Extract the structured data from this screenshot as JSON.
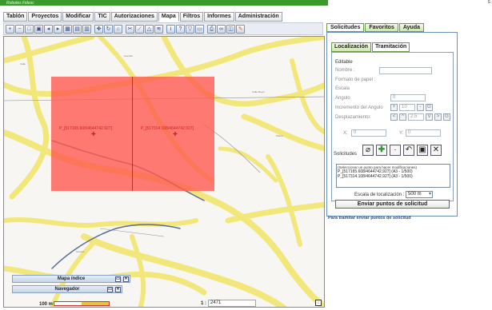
{
  "header": {
    "app_name": "Robotes Fidesc",
    "corner_text": "S"
  },
  "menu": {
    "items": [
      {
        "label": "Tablón"
      },
      {
        "label": "Proyectos"
      },
      {
        "label": "Modificar"
      },
      {
        "label": "TIC"
      },
      {
        "label": "Autorizaciones"
      },
      {
        "label": "Mapa",
        "active": true
      },
      {
        "label": "Filtros"
      },
      {
        "label": "Informes"
      },
      {
        "label": "Administración"
      }
    ]
  },
  "toolbar": {
    "icons": [
      "zoom-in-icon",
      "zoom-out-icon",
      "zoom-box-icon",
      "zoom-extent-icon",
      "previous-view-icon",
      "next-view-icon",
      "grid-icon",
      "grid-alt-icon",
      "grid-select-icon",
      "pan-icon",
      "refresh-icon",
      "home-icon",
      "scissors-icon",
      "measure-line-icon",
      "measure-area-icon",
      "measure-icon",
      "info-icon",
      "query-icon",
      "filter-icon",
      "select-icon",
      "print-icon",
      "link-icon",
      "layers-icon",
      "pencil-icon"
    ]
  },
  "map": {
    "points": [
      {
        "label": "P_[517165.608/4644742.927]"
      },
      {
        "label": "P_[517314.108/4644742.927]"
      }
    ],
    "panels": {
      "index": "Mapa índice",
      "navigator": "Navegador"
    },
    "scalebar": "100 m",
    "scale_prefix": "1 :",
    "scale_value": "2471",
    "corner_icon": "↕"
  },
  "right_panel": {
    "tabs": [
      {
        "label": "Solicitudes",
        "active": true
      },
      {
        "label": "Favoritos"
      },
      {
        "label": "Ayuda"
      }
    ],
    "subtabs": [
      {
        "label": "Localización"
      },
      {
        "label": "Tramitación",
        "active": true
      }
    ],
    "form": {
      "editable": "Editable",
      "nombre_label": "Nombre :",
      "formato_label": "Formato de papel :",
      "escala_label": "Escala",
      "angulo_label": "Angulo",
      "angulo_value": "0",
      "incremento_label": "Incremento del Angulo",
      "inc_plus": "+",
      "inc_value": "10",
      "inc_minus": "-",
      "inc_g": "G",
      "desplaz_label": "Desplazamiento:",
      "desp_left": "<",
      "desp_up": "^",
      "desp_value": "2.5",
      "desp_down": "V",
      "desp_right": ">",
      "desp_g": "G",
      "x_label": "X:",
      "x_value": "0",
      "y_label": "Y:",
      "y_value": "0",
      "solicitudes_label": "Solicitudes",
      "list_hint": "(Seleccionar un punto para hacer modificaciones)",
      "list_items": [
        "P_[517165.608/4644742.927] (A3 - 1/500)",
        "P_[517314.108/4644742.927] (A3 - 1/500)"
      ],
      "escala_loc_label": "Escala de localización :",
      "escala_loc_value": "500 m",
      "send_button": "Enviar puntos de solicitud",
      "footnote": "Para tramitar enviar puntos de solicitud"
    }
  }
}
